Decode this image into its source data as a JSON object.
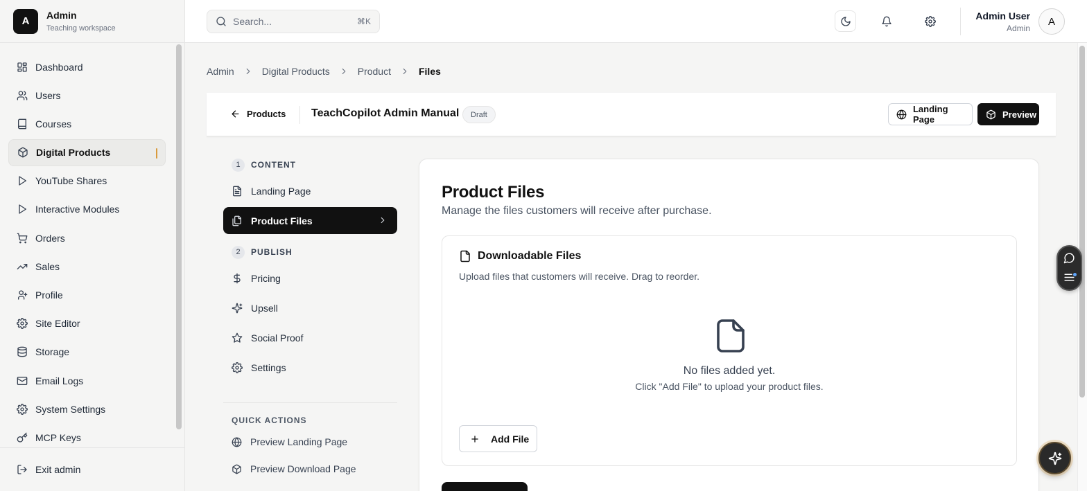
{
  "brand": {
    "logo_letter": "A",
    "title": "Admin",
    "subtitle": "Teaching workspace"
  },
  "sidebar": {
    "items": [
      {
        "label": "Dashboard",
        "icon": "layout-dashboard-icon"
      },
      {
        "label": "Users",
        "icon": "users-icon"
      },
      {
        "label": "Courses",
        "icon": "book-icon"
      },
      {
        "label": "Digital Products",
        "icon": "package-icon",
        "active": true
      },
      {
        "label": "YouTube Shares",
        "icon": "play-icon"
      },
      {
        "label": "Interactive Modules",
        "icon": "play-outline-icon"
      },
      {
        "label": "Orders",
        "icon": "cart-icon"
      },
      {
        "label": "Sales",
        "icon": "trending-up-icon"
      },
      {
        "label": "Profile",
        "icon": "user-icon"
      },
      {
        "label": "Site Editor",
        "icon": "gear-icon"
      },
      {
        "label": "Storage",
        "icon": "database-icon"
      },
      {
        "label": "Email Logs",
        "icon": "mail-icon"
      },
      {
        "label": "System Settings",
        "icon": "gear-icon"
      },
      {
        "label": "MCP Keys",
        "icon": "key-icon"
      }
    ],
    "exit_label": "Exit admin"
  },
  "topbar": {
    "search_placeholder": "Search...",
    "shortcut": "⌘K",
    "user_name": "Admin User",
    "user_role": "Admin",
    "avatar_letter": "A"
  },
  "breadcrumb": [
    "Admin",
    "Digital Products",
    "Product",
    "Files"
  ],
  "header": {
    "back_label": "Products",
    "product_title": "TeachCopilot Admin Manual",
    "status_badge": "Draft",
    "landing_page_button": "Landing Page",
    "preview_button": "Preview"
  },
  "steps": {
    "content_number": "1",
    "content_title": "CONTENT",
    "content_items": [
      {
        "label": "Landing Page",
        "icon": "file-text-icon"
      },
      {
        "label": "Product Files",
        "icon": "files-icon",
        "active": true
      }
    ],
    "publish_number": "2",
    "publish_title": "PUBLISH",
    "publish_items": [
      {
        "label": "Pricing",
        "icon": "dollar-icon"
      },
      {
        "label": "Upsell",
        "icon": "sparkles-icon"
      },
      {
        "label": "Social Proof",
        "icon": "star-icon"
      },
      {
        "label": "Settings",
        "icon": "gear-icon"
      }
    ],
    "quick_actions_title": "QUICK ACTIONS",
    "quick_actions": [
      {
        "label": "Preview Landing Page",
        "icon": "globe-icon"
      },
      {
        "label": "Preview Download Page",
        "icon": "package-icon"
      }
    ]
  },
  "content": {
    "title": "Product Files",
    "subtitle": "Manage the files customers will receive after purchase.",
    "files_title": "Downloadable Files",
    "files_description": "Upload files that customers will receive. Drag to reorder.",
    "empty_title": "No files added yet.",
    "empty_subtitle": "Click \"Add File\" to upload your product files.",
    "add_file_label": "Add File"
  },
  "colors": {
    "accent": "#d99a3c",
    "dark": "#111111",
    "sidebar_bg": "#f5f5f4"
  }
}
